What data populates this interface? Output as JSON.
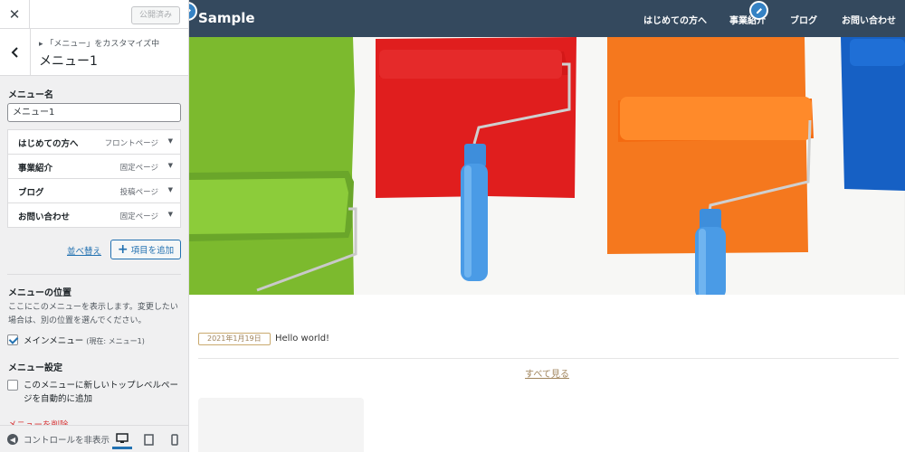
{
  "customizer": {
    "close_symbol": "✕",
    "publish_label": "公開済み",
    "back_symbol": "‹",
    "breadcrumb": "「メニュー」をカスタマイズ中",
    "panel_title": "メニュー1",
    "menu_name_label": "メニュー名",
    "menu_name_value": "メニュー1",
    "menu_items": [
      {
        "title": "はじめての方へ",
        "type": "フロントページ"
      },
      {
        "title": "事業紹介",
        "type": "固定ページ"
      },
      {
        "title": "ブログ",
        "type": "投稿ページ"
      },
      {
        "title": "お問い合わせ",
        "type": "固定ページ"
      }
    ],
    "reorder_label": "並べ替え",
    "add_items_label": "項目を追加",
    "location_heading": "メニューの位置",
    "location_description": "ここにこのメニューを表示します。変更したい場合は、別の位置を選んでください。",
    "location_option": {
      "label": "メインメニュー",
      "sub": "(現在: メニュー1)",
      "checked": true
    },
    "settings_heading": "メニュー設定",
    "auto_add_option": {
      "label": "このメニューに新しいトップレベルページを自動的に追加",
      "checked": false
    },
    "delete_label": "メニューを削除",
    "collapse_label": "コントロールを非表示"
  },
  "preview": {
    "site_title": "Sample",
    "nav": [
      "はじめての方へ",
      "事業紹介",
      "ブログ",
      "お問い合わせ"
    ],
    "post_date": "2021年1月19日",
    "post_title": "Hello world!",
    "see_all_label": "すべて見る"
  },
  "colors": {
    "header_bg": "#34495e",
    "accent_blue": "#2271b1",
    "edit_badge": "#3582c4",
    "gold": "#a0845c",
    "delete_red": "#d63638"
  },
  "icons": {
    "close": "close-icon",
    "back": "chevron-left-icon",
    "dropdown": "caret-down-icon",
    "plus": "plus-icon",
    "collapse": "arrow-left-circle-icon",
    "desktop": "desktop-icon",
    "tablet": "tablet-icon",
    "mobile": "mobile-icon",
    "edit": "pencil-icon"
  }
}
